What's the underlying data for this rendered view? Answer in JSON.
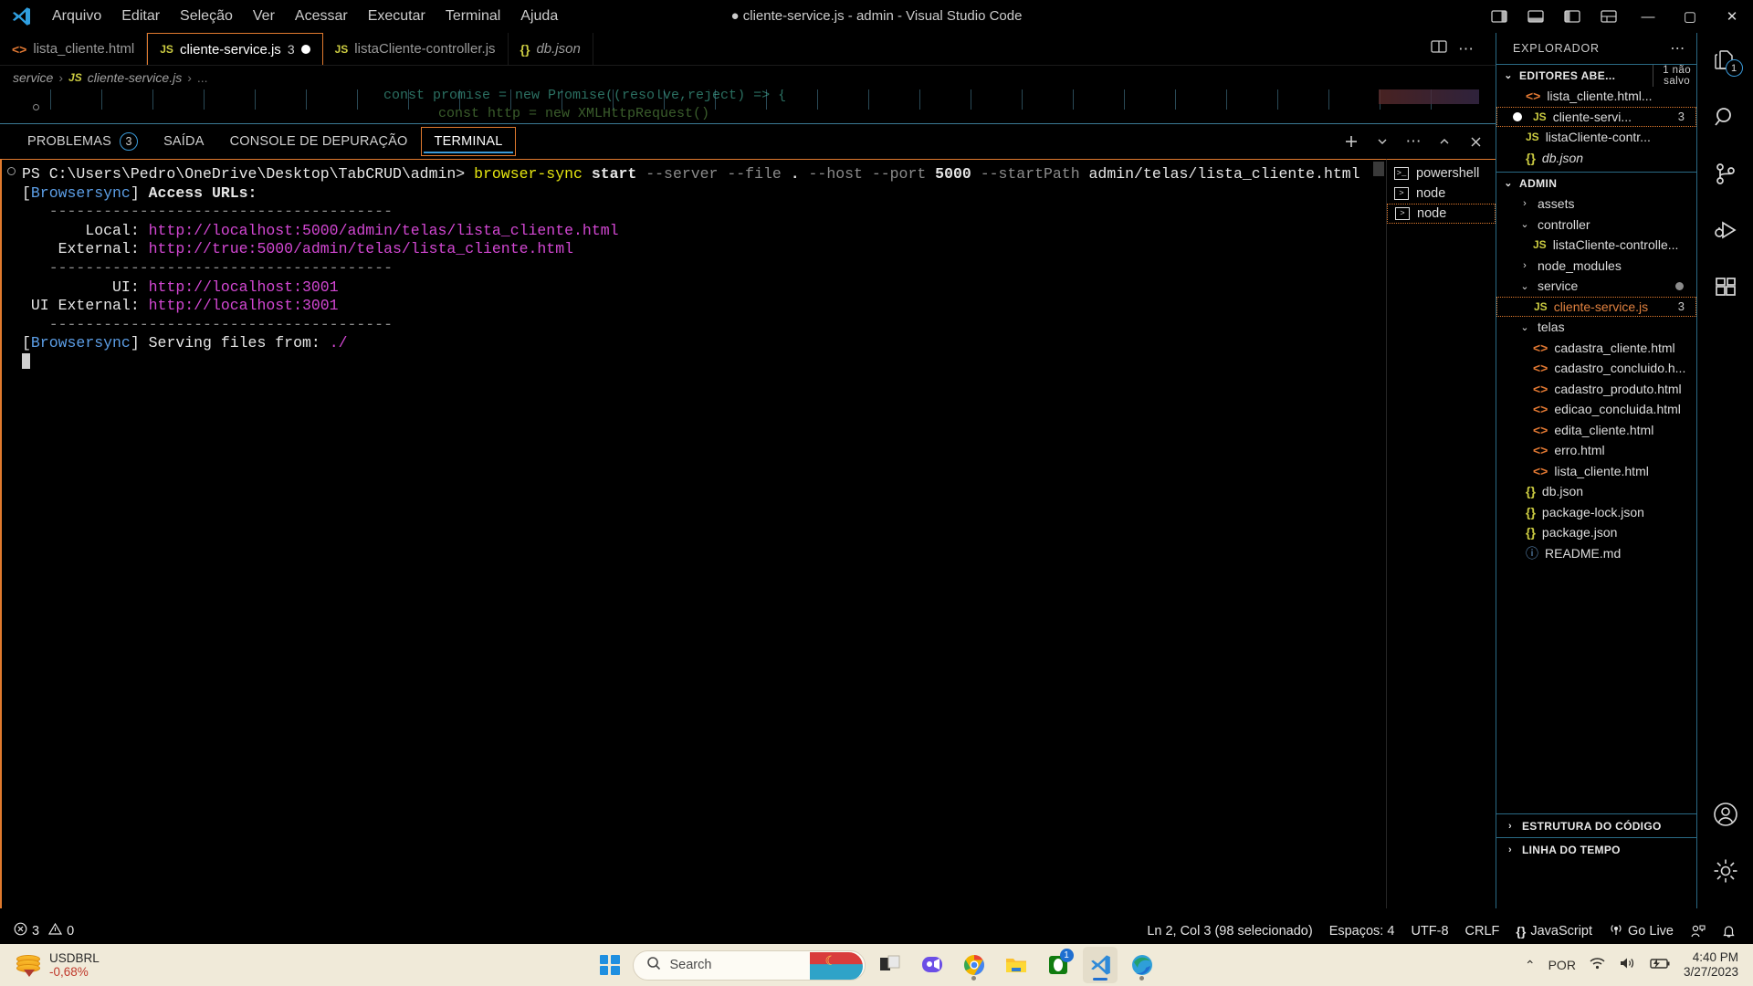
{
  "window": {
    "title": "cliente-service.js - admin - Visual Studio Code",
    "dirty_marker": "●",
    "minimize": "—",
    "maximize": "▢",
    "close": "✕"
  },
  "menu": {
    "items": [
      "Arquivo",
      "Editar",
      "Seleção",
      "Ver",
      "Acessar",
      "Executar",
      "Terminal",
      "Ajuda"
    ]
  },
  "tabs": [
    {
      "label": "lista_cliente.html",
      "icon": "html-icon",
      "badge": "",
      "dirty": false,
      "active": false
    },
    {
      "label": "cliente-service.js",
      "icon": "js-icon",
      "badge": "3",
      "dirty": true,
      "active": true
    },
    {
      "label": "listaCliente-controller.js",
      "icon": "js-icon",
      "badge": "",
      "dirty": false,
      "active": false
    },
    {
      "label": "db.json",
      "icon": "json-icon",
      "badge": "",
      "dirty": false,
      "active": false
    }
  ],
  "breadcrumb": {
    "folder": "service",
    "file": "cliente-service.js",
    "ellipsis": "..."
  },
  "editor_ghost": {
    "line1": "const promise = new Promise((resolve,reject) => {",
    "line2": "const http = new XMLHttpRequest()"
  },
  "panel": {
    "tabs": [
      {
        "label": "PROBLEMAS",
        "badge": "3",
        "active": false
      },
      {
        "label": "SAÍDA",
        "badge": "",
        "active": false
      },
      {
        "label": "CONSOLE DE DEPURAÇÃO",
        "badge": "",
        "active": false
      },
      {
        "label": "TERMINAL",
        "badge": "",
        "active": true
      }
    ],
    "actions": [
      "add-terminal-icon",
      "chevron-down-icon",
      "more-icon",
      "chevron-up-icon",
      "close-icon"
    ]
  },
  "terminal": {
    "prompt": "PS C:\\Users\\Pedro\\OneDrive\\Desktop\\TabCRUD\\admin>",
    "command": {
      "cmd": "browser-sync",
      "sub": "start",
      "flag_server": "--server",
      "flag_file": "--file",
      "dot": ".",
      "flag_host": "--host",
      "flag_port": "--port",
      "port": "5000",
      "flag_startpath": "--startPath",
      "startpath": "admin/telas/lista_cliente.html"
    },
    "lines": {
      "tag": "[Browsersync]",
      "tag_name": "Browsersync",
      "access_urls": "Access URLs:",
      "divider": "--------------------------------------",
      "local_label": "Local:",
      "local_url": "http://localhost:5000/admin/telas/lista_cliente.html",
      "external_label": "External:",
      "external_url": "http://true:5000/admin/telas/lista_cliente.html",
      "ui_label": "UI:",
      "ui_url": "http://localhost:3001",
      "ui_external_label": "UI External:",
      "ui_external_url": "http://localhost:3001",
      "serving_label": "Serving files from:",
      "serving_path": "./"
    },
    "tab_list": [
      {
        "label": "powershell",
        "icon": "terminal-powershell-icon",
        "selected": false
      },
      {
        "label": "node",
        "icon": "terminal-node-icon",
        "selected": false
      },
      {
        "label": "node",
        "icon": "terminal-node-icon",
        "selected": true
      }
    ]
  },
  "sidebar": {
    "title": "EXPLORADOR",
    "more": "⋯",
    "open_editors": {
      "label": "EDITORES ABE...",
      "unsaved_line1": "1 não",
      "unsaved_line2": "salvo",
      "items": [
        {
          "label": "lista_cliente.html...",
          "icon": "html-icon",
          "badge": "",
          "dirty": false,
          "selected": false
        },
        {
          "label": "cliente-servi...",
          "icon": "js-icon",
          "badge": "3",
          "dirty": true,
          "selected": true
        },
        {
          "label": "listaCliente-contr...",
          "icon": "js-icon",
          "badge": "",
          "dirty": false,
          "selected": false
        },
        {
          "label": "db.json",
          "icon": "json-icon",
          "badge": "",
          "dirty": false,
          "selected": false
        }
      ]
    },
    "project": {
      "label": "ADMIN",
      "tree": [
        {
          "label": "assets",
          "type": "folder",
          "expanded": false,
          "depth": 1
        },
        {
          "label": "controller",
          "type": "folder",
          "expanded": true,
          "depth": 1
        },
        {
          "label": "listaCliente-controlle...",
          "type": "js",
          "depth": 2
        },
        {
          "label": "node_modules",
          "type": "folder",
          "expanded": false,
          "depth": 1
        },
        {
          "label": "service",
          "type": "folder",
          "expanded": true,
          "depth": 1,
          "dot": true
        },
        {
          "label": "cliente-service.js",
          "type": "js",
          "depth": 2,
          "badge": "3",
          "selected": true,
          "modified": true
        },
        {
          "label": "telas",
          "type": "folder",
          "expanded": true,
          "depth": 1
        },
        {
          "label": "cadastra_cliente.html",
          "type": "html",
          "depth": 2
        },
        {
          "label": "cadastro_concluido.h...",
          "type": "html",
          "depth": 2
        },
        {
          "label": "cadastro_produto.html",
          "type": "html",
          "depth": 2
        },
        {
          "label": "edicao_concluida.html",
          "type": "html",
          "depth": 2
        },
        {
          "label": "edita_cliente.html",
          "type": "html",
          "depth": 2
        },
        {
          "label": "erro.html",
          "type": "html",
          "depth": 2
        },
        {
          "label": "lista_cliente.html",
          "type": "html",
          "depth": 2
        },
        {
          "label": "db.json",
          "type": "json",
          "depth": 1
        },
        {
          "label": "package-lock.json",
          "type": "json",
          "depth": 1
        },
        {
          "label": "package.json",
          "type": "json",
          "depth": 1
        },
        {
          "label": "README.md",
          "type": "md",
          "depth": 1
        }
      ]
    },
    "bottom_sections": [
      {
        "label": "ESTRUTURA DO CÓDIGO"
      },
      {
        "label": "LINHA DO TEMPO"
      }
    ]
  },
  "activitybar": {
    "items": [
      {
        "name": "explorer-icon",
        "badge": "1",
        "active": true
      },
      {
        "name": "search-icon",
        "badge": "",
        "active": false
      },
      {
        "name": "source-control-icon",
        "badge": "",
        "active": false
      },
      {
        "name": "run-debug-icon",
        "badge": "",
        "active": false
      },
      {
        "name": "extensions-icon",
        "badge": "",
        "active": false
      }
    ],
    "bottom": [
      {
        "name": "accounts-icon"
      },
      {
        "name": "settings-gear-icon"
      }
    ]
  },
  "statusbar": {
    "errors": "3",
    "warnings": "0",
    "cursor": "Ln 2, Col 3 (98 selecionado)",
    "spaces": "Espaços: 4",
    "encoding": "UTF-8",
    "eol": "CRLF",
    "language": "JavaScript",
    "golive": "Go Live",
    "feedback_icon": "feedback-icon",
    "bell_icon": "bell-icon"
  },
  "taskbar": {
    "widget": {
      "title": "USDBRL",
      "change": "-0,68%"
    },
    "search_placeholder": "Search",
    "apps": [
      {
        "name": "task-view-icon",
        "badge": "",
        "running": false,
        "active": false
      },
      {
        "name": "discord-icon",
        "badge": "",
        "running": false,
        "active": false
      },
      {
        "name": "chrome-icon",
        "badge": "",
        "running": true,
        "active": false
      },
      {
        "name": "file-explorer-icon",
        "badge": "",
        "running": false,
        "active": false
      },
      {
        "name": "xbox-icon",
        "badge": "1",
        "running": false,
        "active": false
      },
      {
        "name": "vscode-icon",
        "badge": "",
        "running": true,
        "active": true
      },
      {
        "name": "edge-icon",
        "badge": "",
        "running": true,
        "active": false
      }
    ],
    "tray": {
      "chevron": "⌃",
      "language": "POR",
      "wifi": "wifi-icon",
      "volume": "volume-icon",
      "battery": "battery-charging-icon"
    },
    "clock": {
      "time": "4:40 PM",
      "date": "3/27/2023"
    }
  }
}
